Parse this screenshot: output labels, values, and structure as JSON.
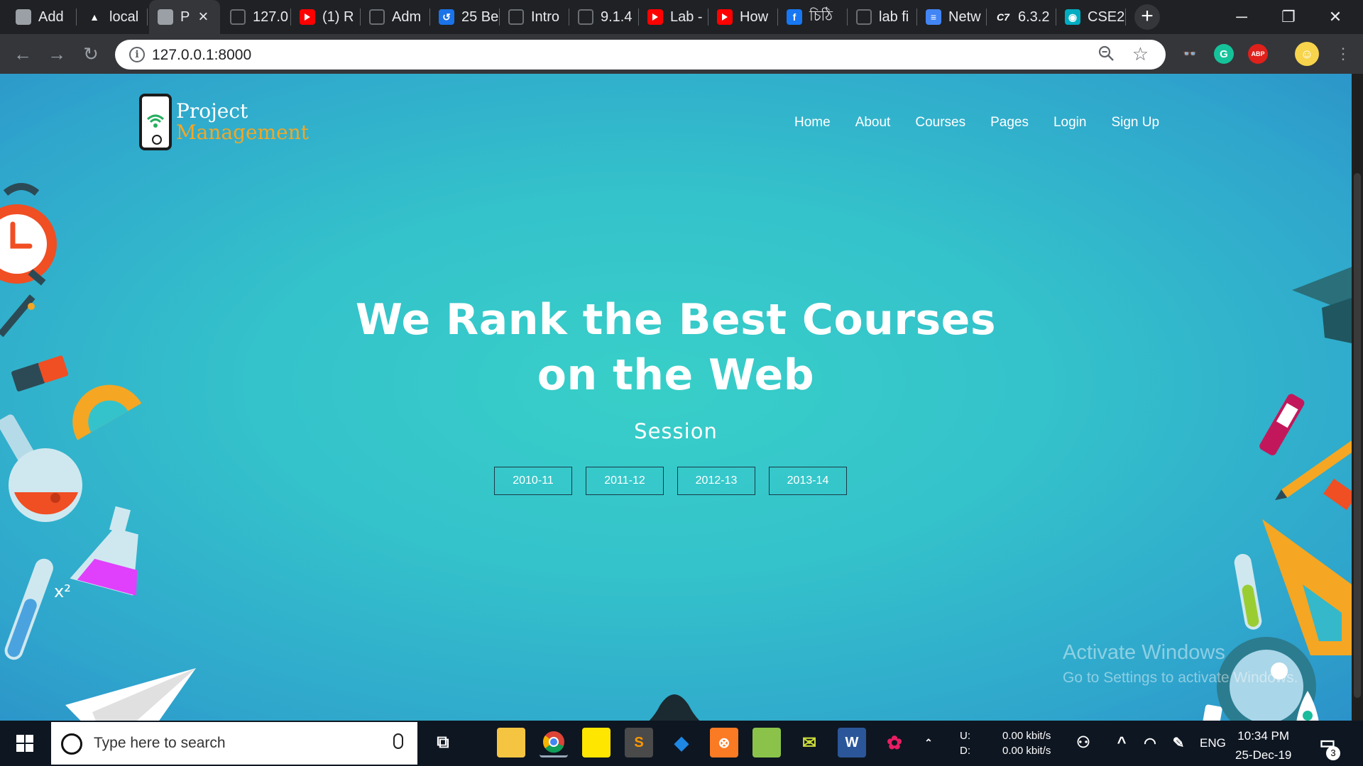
{
  "browser": {
    "tabs": [
      {
        "title": "Add",
        "icon": "page-icon"
      },
      {
        "title": "local",
        "icon": "xampp-icon"
      },
      {
        "title": "P",
        "icon": "page-icon",
        "active": true
      },
      {
        "title": "127.0",
        "icon": "globe-icon"
      },
      {
        "title": "(1) R",
        "icon": "youtube-icon"
      },
      {
        "title": "Adm",
        "icon": "globe-icon"
      },
      {
        "title": "25 Be",
        "icon": "blue-app-icon"
      },
      {
        "title": "Intro",
        "icon": "globe-icon"
      },
      {
        "title": "9.1.4",
        "icon": "globe-icon"
      },
      {
        "title": "Lab -",
        "icon": "youtube-icon"
      },
      {
        "title": "How",
        "icon": "youtube-icon"
      },
      {
        "title": "চিঠি",
        "icon": "facebook-icon"
      },
      {
        "title": "lab fi",
        "icon": "globe-icon"
      },
      {
        "title": "Netw",
        "icon": "docs-icon"
      },
      {
        "title": "6.3.2",
        "icon": "c7-icon"
      },
      {
        "title": "CSE2",
        "icon": "classroom-icon"
      }
    ],
    "new_tab_label": "+",
    "url": "127.0.0.1:8000",
    "extensions": [
      "incognito-ext-icon",
      "grammarly-icon",
      "adblock-plus-icon",
      "profile-avatar"
    ],
    "extension_labels": {
      "grammarly": "G",
      "abp": "ABP"
    }
  },
  "site": {
    "logo": {
      "line1": "Project",
      "line2": "Management"
    },
    "nav": [
      "Home",
      "About",
      "Courses",
      "Pages",
      "Login",
      "Sign Up"
    ],
    "hero": {
      "title_line1": "We Rank the Best Courses",
      "title_line2": "on the Web",
      "subtitle": "Session",
      "sessions": [
        "2010-11",
        "2011-12",
        "2012-13",
        "2013-14"
      ]
    },
    "decor_text": "x²"
  },
  "watermark": {
    "line1": "Activate Windows",
    "line2": "Go to Settings to activate Windows."
  },
  "taskbar": {
    "search_placeholder": "Type here to search",
    "network": {
      "up_label": "U:",
      "down_label": "D:",
      "up_value": "0.00 kbit/s",
      "down_value": "0.00 kbit/s"
    },
    "language": "ENG",
    "time": "10:34 PM",
    "date": "25-Dec-19",
    "notifications": "3"
  },
  "colors": {
    "hero_bg": "#34c2cb",
    "logo_accent": "#f5a623",
    "tab_bg": "#202124",
    "active_tab_bg": "#35363a"
  }
}
